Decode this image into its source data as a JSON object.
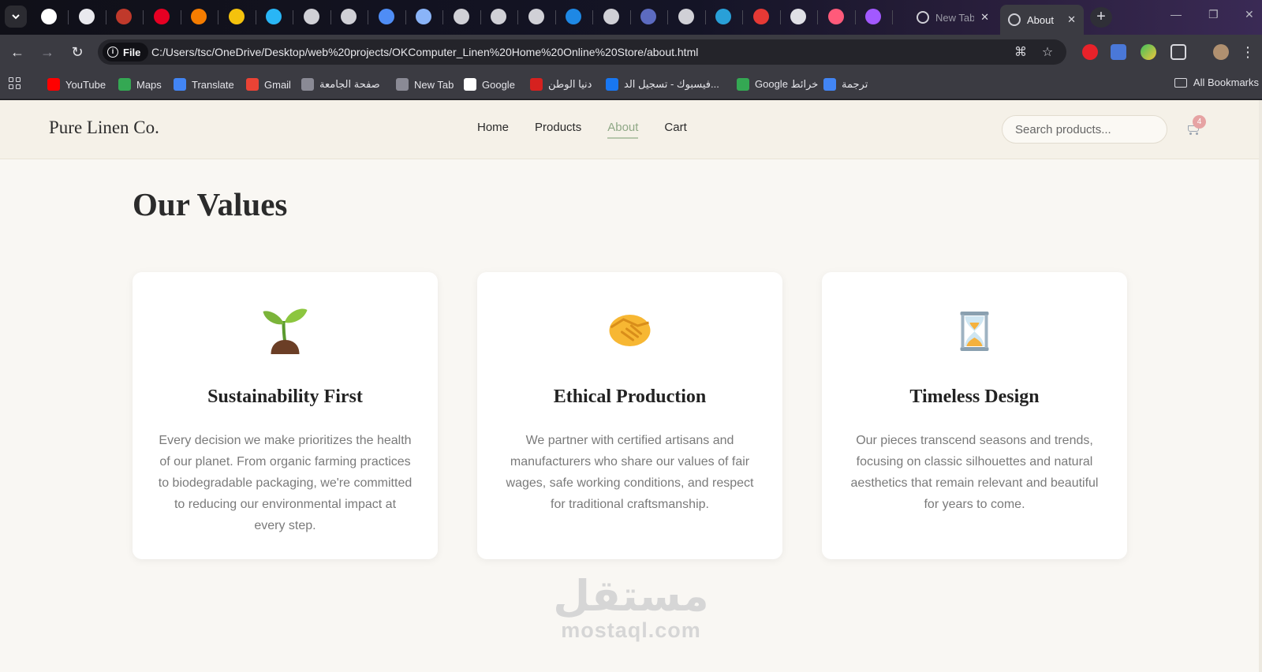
{
  "browser": {
    "tabs": [
      {
        "title": "New Tab",
        "state": "inactive"
      },
      {
        "title": "About",
        "state": "active"
      }
    ],
    "address_bar": {
      "scheme_chip": "File",
      "url": "C:/Users/tsc/OneDrive/Desktop/web%20projects/OKComputer_Linen%20Home%20Online%20Store/about.html"
    },
    "bookmarks": [
      {
        "label": "YouTube",
        "icon": "youtube-icon",
        "color": "#ff0000"
      },
      {
        "label": "Maps",
        "icon": "maps-pin-icon",
        "color": "#34a853"
      },
      {
        "label": "Translate",
        "icon": "translate-icon",
        "color": "#4285f4"
      },
      {
        "label": "Gmail",
        "icon": "gmail-icon",
        "color": "#ea4335"
      },
      {
        "label": "صفحة الجامعة",
        "icon": "university-icon",
        "color": "#8a8a95"
      },
      {
        "label": "New Tab",
        "icon": "globe-icon",
        "color": "#8a8a95"
      },
      {
        "label": "Google",
        "icon": "google-icon",
        "color": "#ffffff"
      },
      {
        "label": "دنيا الوطن",
        "icon": "news-icon",
        "color": "#d6211f"
      },
      {
        "label": "فيسبوك - تسجيل الد...",
        "icon": "facebook-icon",
        "color": "#1877f2"
      },
      {
        "label": "Google خرائط",
        "icon": "maps-pin-icon",
        "color": "#34a853"
      },
      {
        "label": "ترجمة",
        "icon": "translate-icon",
        "color": "#4285f4"
      }
    ],
    "all_bookmarks_label": "All Bookmarks"
  },
  "site": {
    "logo": "Pure Linen Co.",
    "nav": [
      {
        "label": "Home",
        "active": false
      },
      {
        "label": "Products",
        "active": false
      },
      {
        "label": "About",
        "active": true
      },
      {
        "label": "Cart",
        "active": false
      }
    ],
    "search_placeholder": "Search products...",
    "cart_count": "4",
    "accent_color": "#8fa886"
  },
  "values_section": {
    "title": "Our Values",
    "cards": [
      {
        "icon": "seedling-icon",
        "title": "Sustainability First",
        "text": "Every decision we make prioritizes the health of our planet. From organic farming practices to biodegradable packaging, we're committed to reducing our environmental impact at every step."
      },
      {
        "icon": "handshake-icon",
        "title": "Ethical Production",
        "text": "We partner with certified artisans and manufacturers who share our values of fair wages, safe working conditions, and respect for traditional craftsmanship."
      },
      {
        "icon": "hourglass-icon",
        "title": "Timeless Design",
        "text": "Our pieces transcend seasons and trends, focusing on classic silhouettes and natural aesthetics that remain relevant and beautiful for years to come."
      }
    ]
  },
  "watermark": {
    "arabic": "مستقل",
    "latin": "mostaql.com"
  }
}
